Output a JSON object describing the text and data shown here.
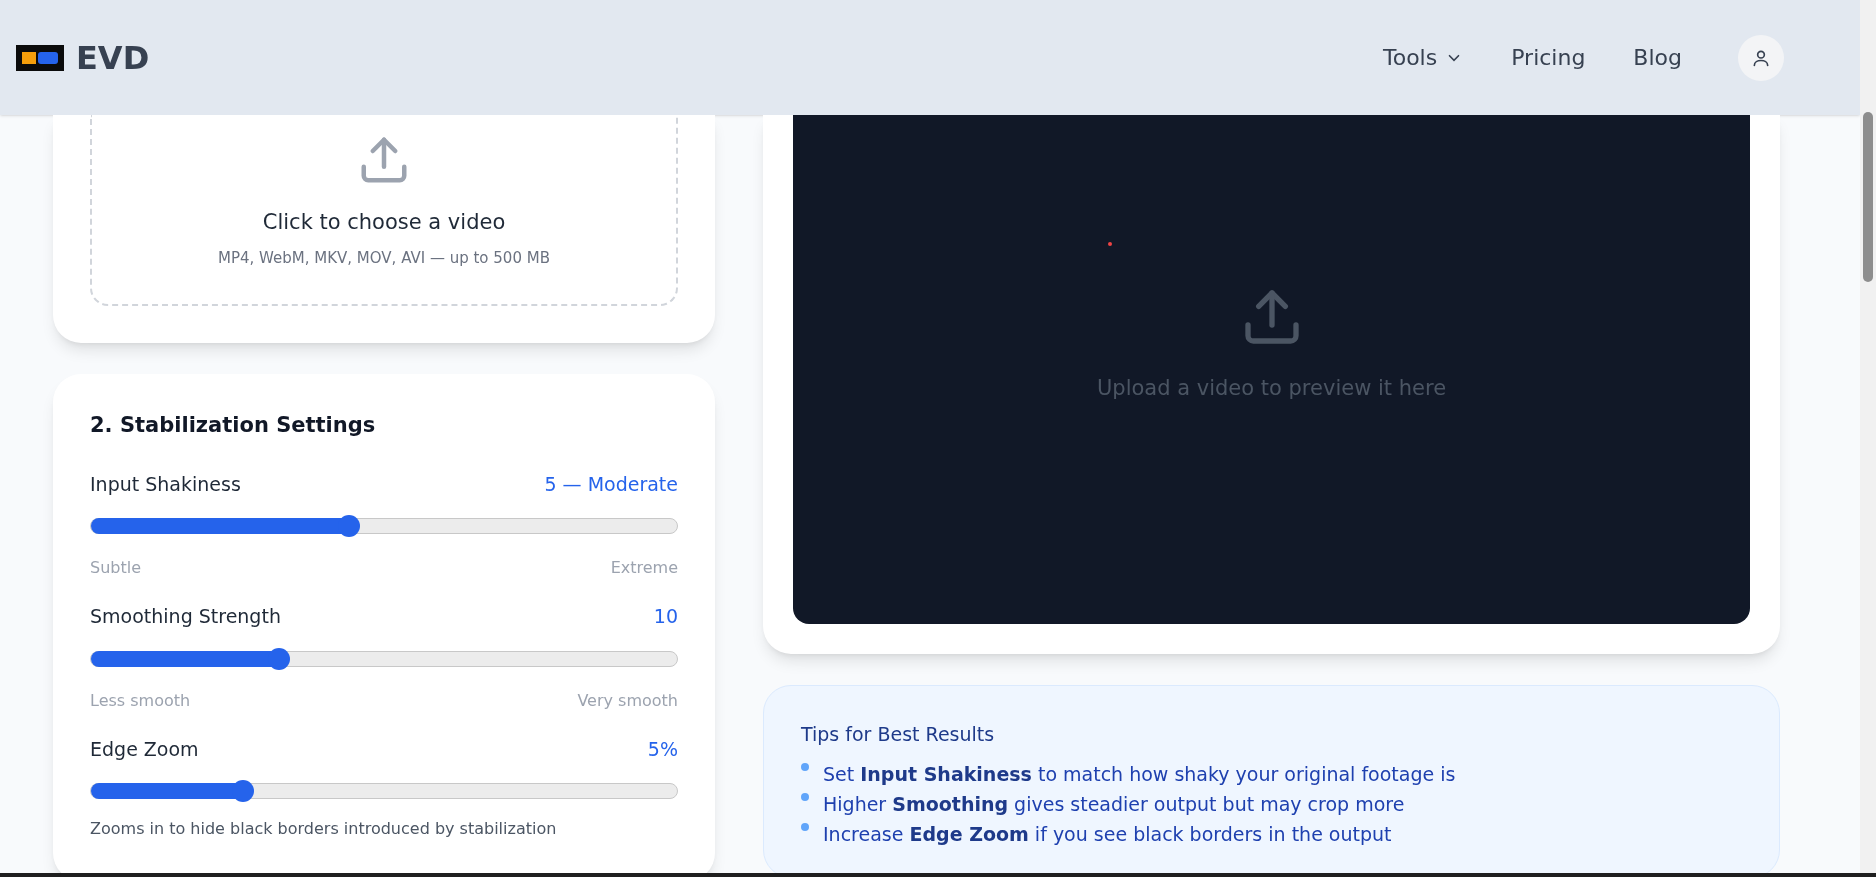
{
  "header": {
    "brand": "EVD",
    "nav": [
      {
        "label": "Tools",
        "kind": "dropdown"
      },
      {
        "label": "Pricing",
        "kind": "link"
      },
      {
        "label": "Blog",
        "kind": "link"
      }
    ]
  },
  "upload": {
    "title": "Click to choose a video",
    "hint": "MP4, WebM, MKV, MOV, AVI — up to 500 MB"
  },
  "settings": {
    "title": "2. Stabilization Settings",
    "sliders": [
      {
        "label": "Input Shakiness",
        "value": "5 — Moderate",
        "level": 0.44,
        "min_label": "Subtle",
        "max_label": "Extreme"
      },
      {
        "label": "Smoothing Strength",
        "value": "10",
        "level": 0.32,
        "min_label": "Less smooth",
        "max_label": "Very smooth"
      },
      {
        "label": "Edge Zoom",
        "value": "5%",
        "level": 0.26,
        "note": "Zooms in to hide black borders introduced by stabilization"
      }
    ]
  },
  "preview": {
    "message": "Upload a video to preview it here"
  },
  "tips": {
    "title": "Tips for Best Results",
    "items": [
      "Set **Input Shakiness** to match how shaky your original footage is",
      "Higher **Smoothing** gives steadier output but may crop more",
      "Increase **Edge Zoom** if you see black borders in the output"
    ]
  }
}
